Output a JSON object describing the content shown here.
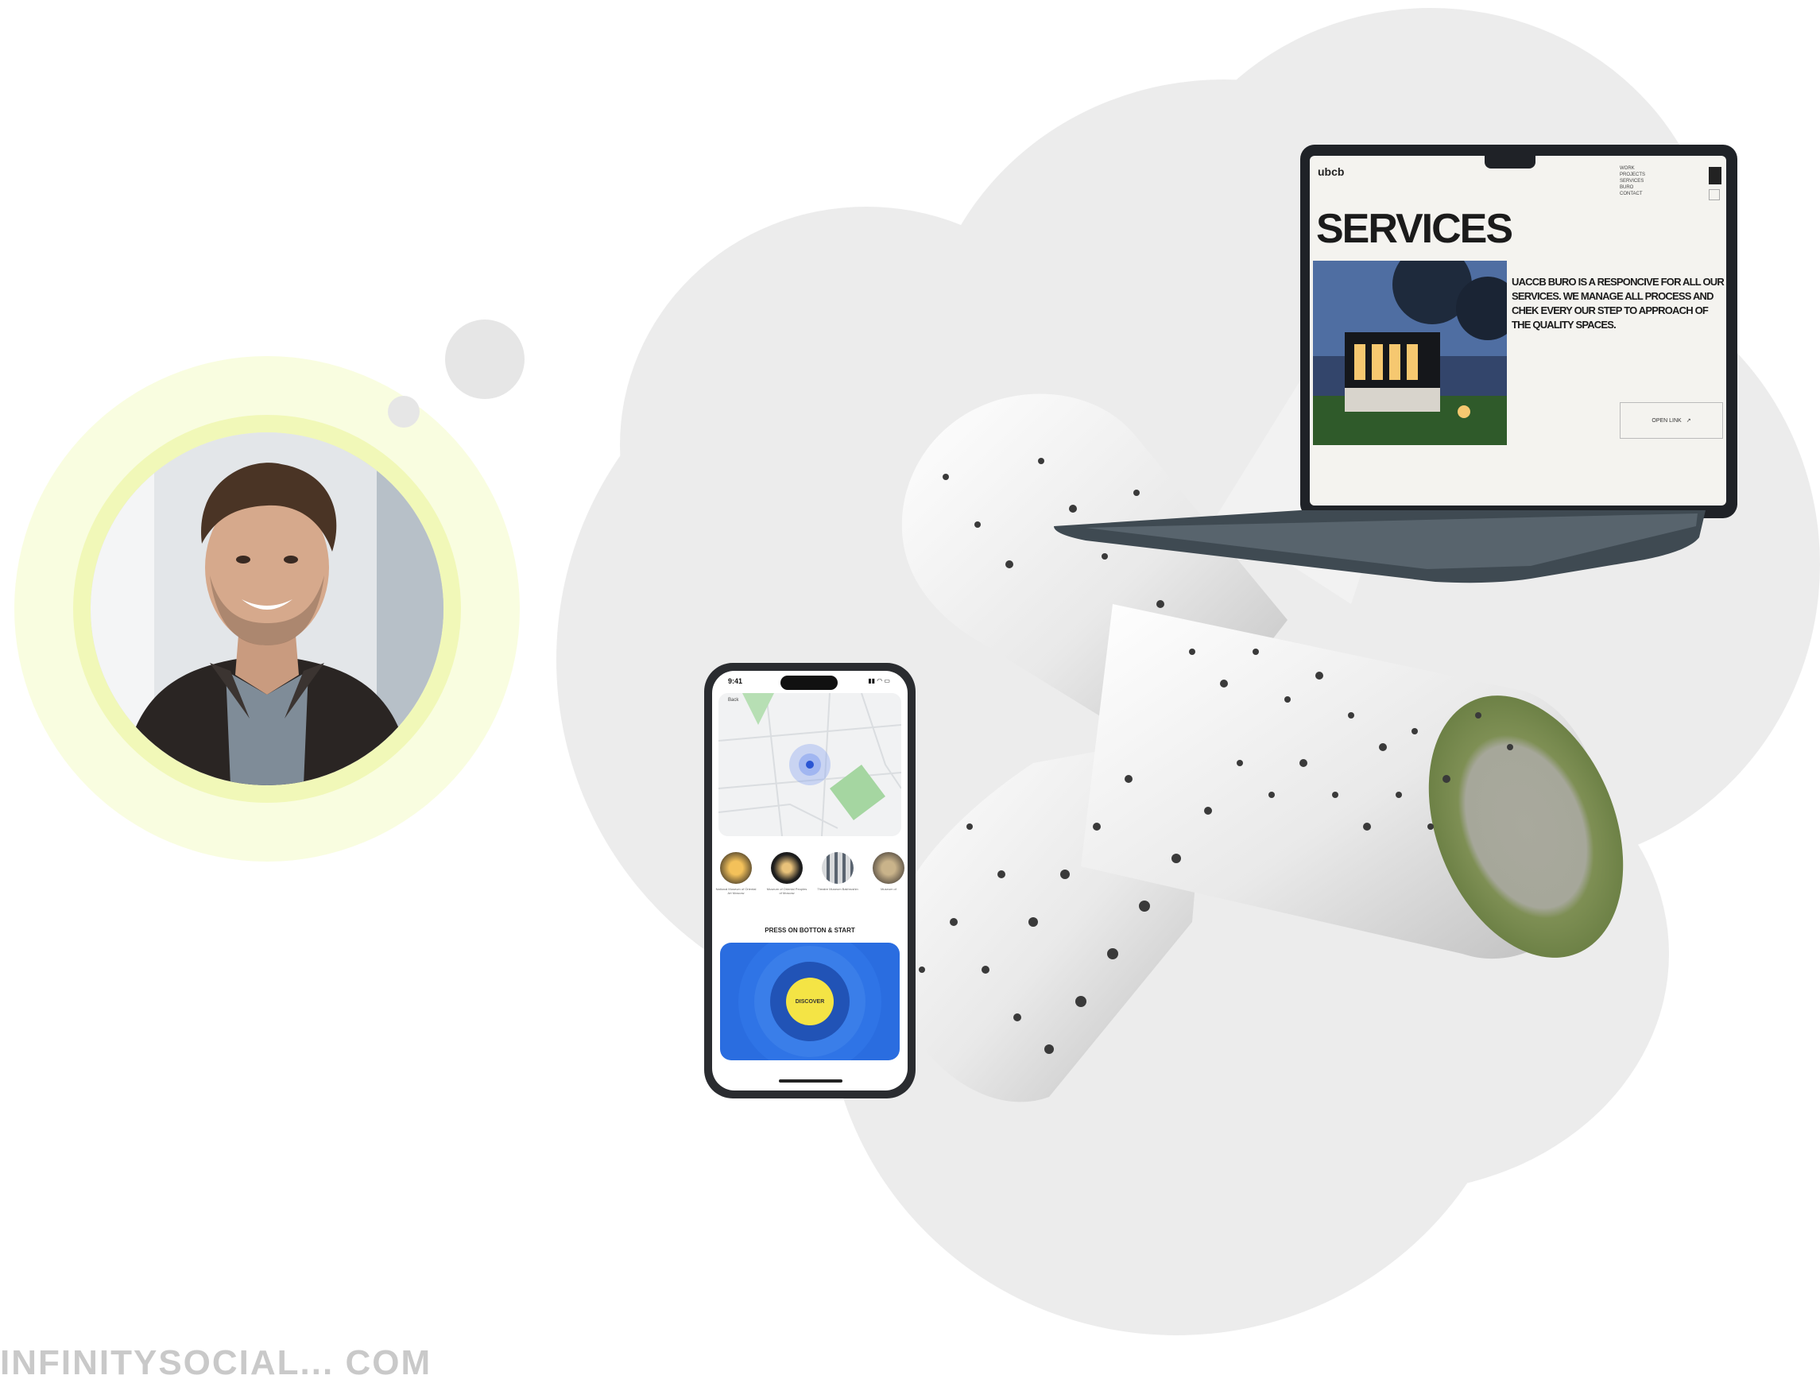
{
  "laptop": {
    "logo": "ubcb",
    "nav": [
      "WORK",
      "PROJECTS",
      "SERVICES",
      "BURO",
      "CONTACT"
    ],
    "title": "SERVICES",
    "description": "UACCB BURO IS A RESPONCIVE FOR ALL OUR SERVICES. WE MANAGE ALL PROCESS AND CHEK EVERY OUR STEP TO APPROACH OF THE QUALITY SPACES.",
    "button_label": "OPEN LINK",
    "button_arrow": "↗"
  },
  "phone": {
    "time": "9:41",
    "status": "▮▮ ◠ ▭",
    "back_label": "Back",
    "places": [
      {
        "label": "National Museum of Oriental Art Moscow"
      },
      {
        "label": "Museum of Oriental Peoples of Moscow"
      },
      {
        "label": "Theatre Museum Bakhrushin"
      },
      {
        "label": "Museum of"
      }
    ],
    "cta": "PRESS ON BOTTON & START",
    "discover_label": "DISCOVER"
  },
  "footer": {
    "text": "INFINITYSOCIAL... COM"
  },
  "colors": {
    "cloud": "#ececec",
    "halo_outer": "#f9fde0",
    "halo_inner": "#f1f8b8",
    "phone_panel": "#2a6de0",
    "discover_button": "#f4e445"
  }
}
